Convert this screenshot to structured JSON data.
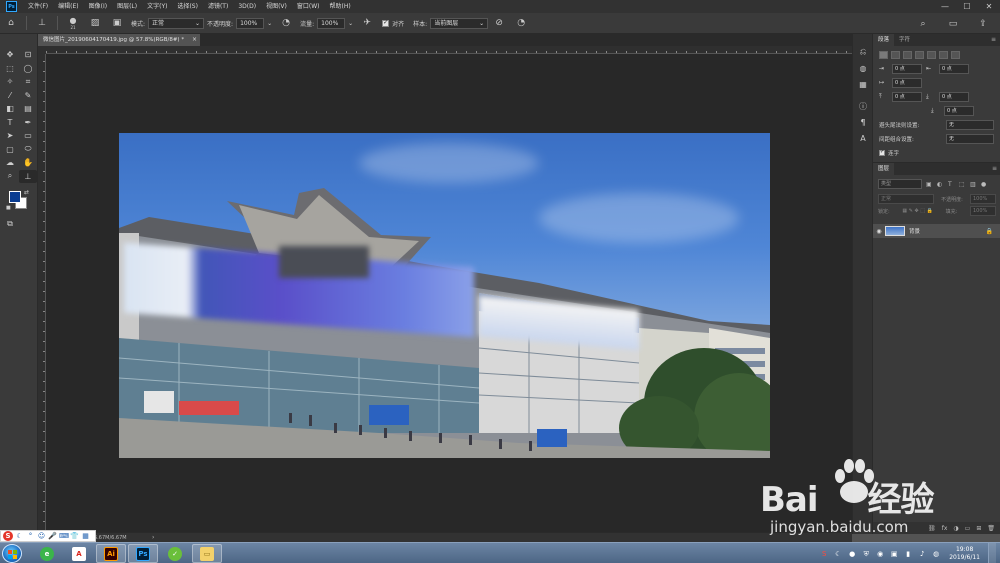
{
  "app": {
    "logo": "Ps"
  },
  "menu": [
    "文件(F)",
    "编辑(E)",
    "图像(I)",
    "图层(L)",
    "文字(Y)",
    "选择(S)",
    "滤镜(T)",
    "3D(D)",
    "视图(V)",
    "窗口(W)",
    "帮助(H)"
  ],
  "window_controls": {
    "minimize": "—",
    "maximize": "☐",
    "close": "✕"
  },
  "options": {
    "brush_size": "21",
    "mode_label": "模式:",
    "mode_value": "正常",
    "opacity_label": "不透明度:",
    "opacity_value": "100%",
    "flow_label": "流量:",
    "flow_value": "100%",
    "align_label": "对齐",
    "sample_label": "样本:",
    "sample_value": "当前图层"
  },
  "document": {
    "tab_title": "微信图片_20190604170419.jpg @ 57.8%(RGB/8#) *",
    "close": "×"
  },
  "colors": {
    "foreground": "#0b3d91",
    "background": "#ffffff",
    "accent": "#31a8ff"
  },
  "paragraph_panel": {
    "tabs": [
      "段落",
      "字符"
    ],
    "indent_left": "0 点",
    "indent_right": "0 点",
    "indent_first": "0 点",
    "space_before": "0 点",
    "space_after": "0 点",
    "space_after_2": "0 点",
    "kinsoku_label": "避头尾法则设置:",
    "kinsoku_value": "无",
    "mojikumi_label": "间距组合设置:",
    "mojikumi_value": "无",
    "hyphenate_label": "连字"
  },
  "layers_panel": {
    "tab": "图层",
    "filter_placeholder": "类型",
    "blend_mode": "正常",
    "opacity_label": "不透明度:",
    "opacity_value": "100%",
    "lock_label": "锁定:",
    "fill_label": "填充:",
    "fill_value": "100%",
    "layer_name": "背景"
  },
  "status": {
    "doc_size": "6.67M/6.67M",
    "arrow": "›"
  },
  "taskbar": {
    "clock_time": "19:08",
    "clock_date": "2019/6/11"
  },
  "watermark": {
    "brand": "Bai",
    "brand_tail": "经验",
    "url": "jingyan.baidu.com"
  }
}
